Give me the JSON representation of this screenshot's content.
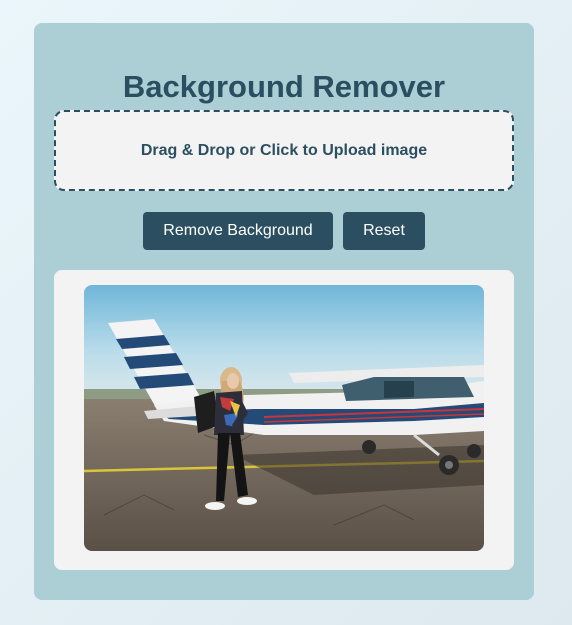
{
  "app": {
    "title": "Background Remover"
  },
  "upload": {
    "label": "Drag & Drop or Click to Upload image"
  },
  "actions": {
    "remove_label": "Remove Background",
    "reset_label": "Reset"
  },
  "preview": {
    "image_description": "woman-with-backpack-standing-by-small-airplane"
  },
  "colors": {
    "card_background": "#abcfd5",
    "accent": "#2b4f61",
    "panel_background": "#f3f3f3",
    "page_background": "#e3eef4"
  }
}
